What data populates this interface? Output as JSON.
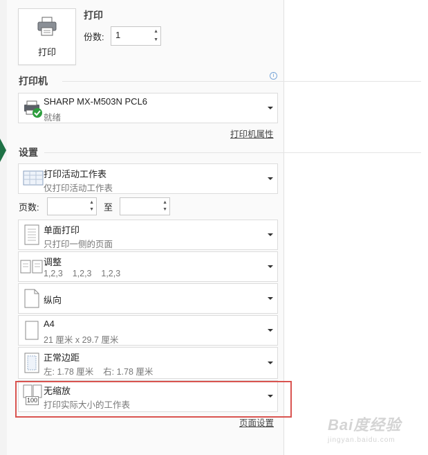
{
  "print": {
    "button_label": "打印",
    "heading": "打印",
    "copies_label": "份数:",
    "copies_value": "1"
  },
  "printer": {
    "heading": "打印机",
    "name": "SHARP MX-M503N PCL6",
    "status": "就绪",
    "properties_link": "打印机属性"
  },
  "settings": {
    "heading": "设置",
    "what_to_print": {
      "title": "打印活动工作表",
      "subtitle": "仅打印活动工作表"
    },
    "pages_label": "页数:",
    "pages_from": "",
    "to_label": "至",
    "pages_to": "",
    "sides": {
      "title": "单面打印",
      "subtitle": "只打印一侧的页面"
    },
    "collate": {
      "title": "调整",
      "subtitle": "1,2,3    1,2,3    1,2,3"
    },
    "orientation": {
      "title": "纵向"
    },
    "paper": {
      "title": "A4",
      "subtitle": "21 厘米 x 29.7 厘米"
    },
    "margins": {
      "title": "正常边距",
      "subtitle": "左: 1.78 厘米    右: 1.78 厘米"
    },
    "scaling": {
      "title": "无缩放",
      "subtitle": "打印实际大小的工作表",
      "icon_text": "100"
    },
    "page_setup_link": "页面设置"
  },
  "watermark": {
    "line1": "Bai度经验",
    "line2": "jingyan.baidu.com"
  },
  "colors": {
    "highlight": "#d9534f",
    "excel_green": "#1e7145",
    "ready_check": "#2e9e3e"
  }
}
